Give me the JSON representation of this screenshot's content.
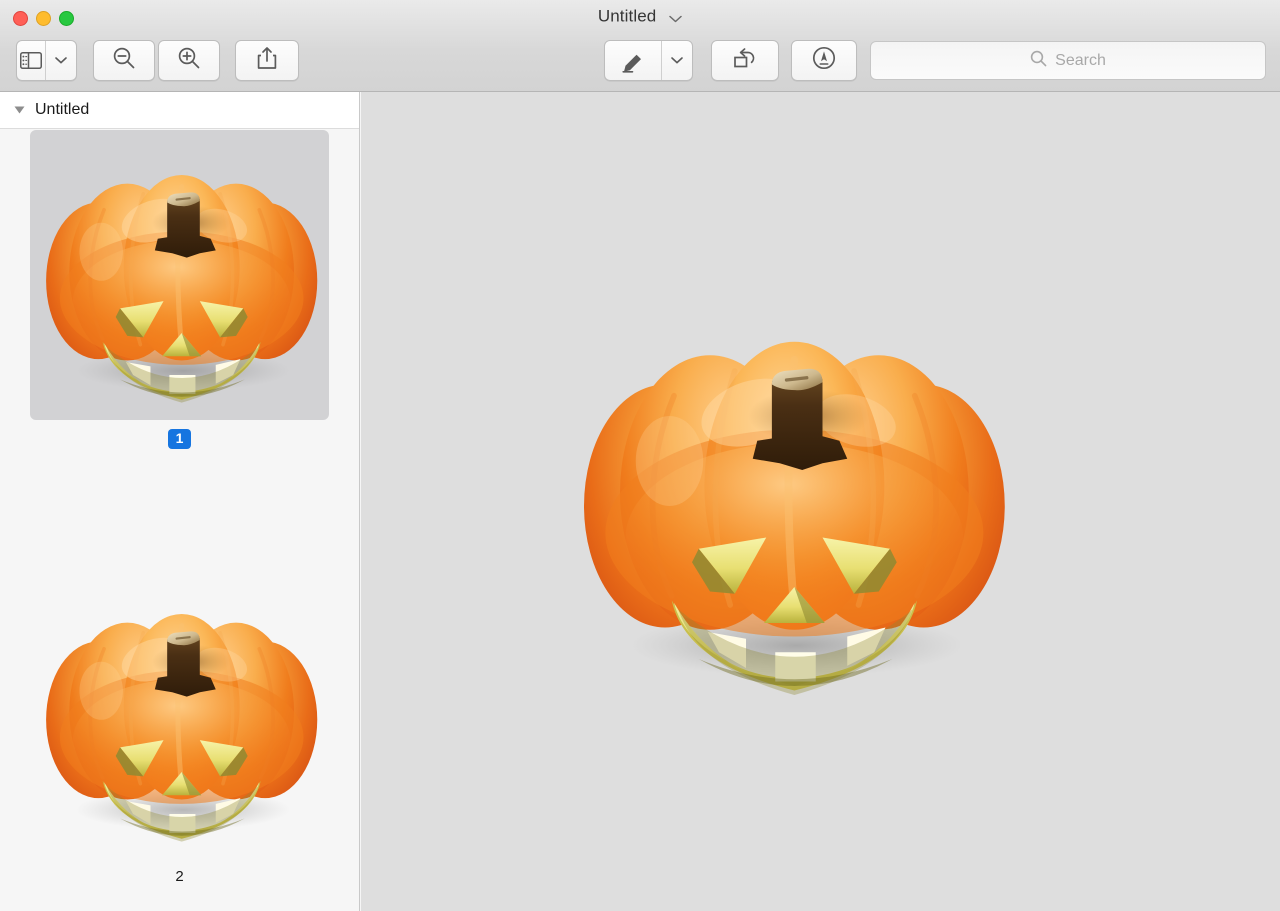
{
  "window": {
    "title": "Untitled",
    "title_chevron_icon": "chevron-down-icon",
    "traffic_lights": [
      {
        "name": "close",
        "color": "#ff5f57"
      },
      {
        "name": "minimize",
        "color": "#febc2e"
      },
      {
        "name": "zoom",
        "color": "#28c840"
      }
    ]
  },
  "toolbar": {
    "sidebar_button": {
      "icon": "sidebar-icon",
      "chevron_icon": "chevron-down-icon",
      "label": ""
    },
    "zoom_out_button": {
      "icon": "zoom-out-icon",
      "label": ""
    },
    "zoom_in_button": {
      "icon": "zoom-in-icon",
      "label": ""
    },
    "share_button": {
      "icon": "share-icon",
      "label": ""
    },
    "markup_button": {
      "icon": "markup-pen-icon",
      "chevron_icon": "chevron-down-icon",
      "label": ""
    },
    "rotate_button": {
      "icon": "rotate-left-icon",
      "label": ""
    },
    "sign_button": {
      "icon": "sign-icon",
      "label": ""
    }
  },
  "search": {
    "placeholder": "Search",
    "value": "",
    "icon": "search-icon"
  },
  "sidebar": {
    "header": {
      "label": "Untitled",
      "disclosure_icon": "disclosure-triangle-icon",
      "expanded": true
    },
    "thumbnails": [
      {
        "page_label": "1",
        "selected": true,
        "image_alt": "jack-o-lantern-pumpkin",
        "selection_color": "#1675e0"
      },
      {
        "page_label": "2",
        "selected": false,
        "image_alt": "jack-o-lantern-pumpkin",
        "selection_color": "#1675e0"
      }
    ]
  },
  "canvas": {
    "background_color": "#dedede",
    "image_alt": "jack-o-lantern-pumpkin"
  },
  "colors": {
    "accent": "#1675e0",
    "toolbar_bg": "#d8d8d8",
    "sidebar_bg": "#f6f6f6",
    "canvas_bg": "#dedede",
    "thumb_selected_bg": "#d2d2d4",
    "pumpkin_orange": "#f58220",
    "pumpkin_light": "#fbbe63",
    "pumpkin_deep": "#e8622a",
    "stem_brown": "#4a2f14",
    "face_glow": "#f5f0a0"
  }
}
